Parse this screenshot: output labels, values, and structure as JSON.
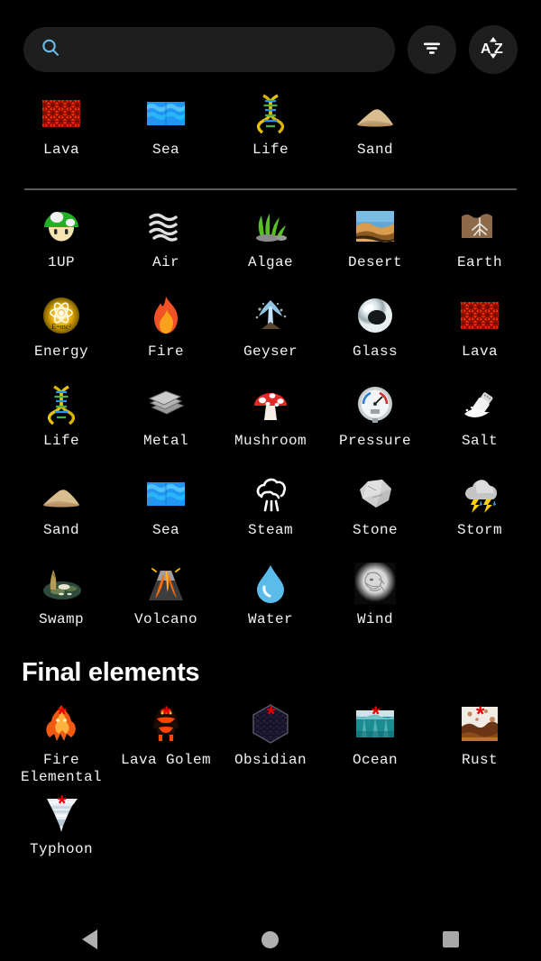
{
  "app": {
    "background": "#000000",
    "accent_blue": "#6cb8e8",
    "star_color": "#e60000"
  },
  "search": {
    "value": "",
    "placeholder": "",
    "icon": "search-icon"
  },
  "toolbar": {
    "filter_label": "filter-icon",
    "sort_label": "sort-az-icon"
  },
  "recent": {
    "items": [
      {
        "label": "Lava",
        "icon": "lava-icon"
      },
      {
        "label": "Sea",
        "icon": "sea-icon"
      },
      {
        "label": "Life",
        "icon": "life-dna-icon"
      },
      {
        "label": "Sand",
        "icon": "sand-icon"
      }
    ]
  },
  "elements": {
    "items": [
      {
        "label": "1UP",
        "icon": "mushroom-1up-icon"
      },
      {
        "label": "Air",
        "icon": "air-wind-lines-icon"
      },
      {
        "label": "Algae",
        "icon": "algae-icon"
      },
      {
        "label": "Desert",
        "icon": "desert-icon"
      },
      {
        "label": "Earth",
        "icon": "earth-soil-icon"
      },
      {
        "label": "Energy",
        "icon": "energy-atom-icon"
      },
      {
        "label": "Fire",
        "icon": "fire-icon"
      },
      {
        "label": "Geyser",
        "icon": "geyser-icon"
      },
      {
        "label": "Glass",
        "icon": "glass-orb-icon"
      },
      {
        "label": "Lava",
        "icon": "lava-icon"
      },
      {
        "label": "Life",
        "icon": "life-dna-icon"
      },
      {
        "label": "Metal",
        "icon": "metal-sheets-icon"
      },
      {
        "label": "Mushroom",
        "icon": "mushroom-icon"
      },
      {
        "label": "Pressure",
        "icon": "pressure-gauge-icon"
      },
      {
        "label": "Salt",
        "icon": "salt-shaker-icon"
      },
      {
        "label": "Sand",
        "icon": "sand-icon"
      },
      {
        "label": "Sea",
        "icon": "sea-icon"
      },
      {
        "label": "Steam",
        "icon": "steam-cloud-icon"
      },
      {
        "label": "Stone",
        "icon": "stone-rock-icon"
      },
      {
        "label": "Storm",
        "icon": "storm-cloud-icon"
      },
      {
        "label": "Swamp",
        "icon": "swamp-icon"
      },
      {
        "label": "Volcano",
        "icon": "volcano-icon"
      },
      {
        "label": "Water",
        "icon": "water-drop-icon"
      },
      {
        "label": "Wind",
        "icon": "wind-face-icon"
      }
    ]
  },
  "final_section": {
    "title": "Final elements",
    "star_marker": "*",
    "items": [
      {
        "label": "Fire Elemental",
        "icon": "fire-elemental-icon",
        "starred": true
      },
      {
        "label": "Lava Golem",
        "icon": "lava-golem-icon",
        "starred": true
      },
      {
        "label": "Obsidian",
        "icon": "obsidian-icon",
        "starred": true
      },
      {
        "label": "Ocean",
        "icon": "ocean-icon",
        "starred": true
      },
      {
        "label": "Rust",
        "icon": "rust-icon",
        "starred": true
      },
      {
        "label": "Typhoon",
        "icon": "typhoon-icon",
        "starred": true
      }
    ]
  },
  "navbar": {
    "back": "back-nav-button",
    "home": "home-nav-button",
    "recents": "recents-nav-button"
  }
}
